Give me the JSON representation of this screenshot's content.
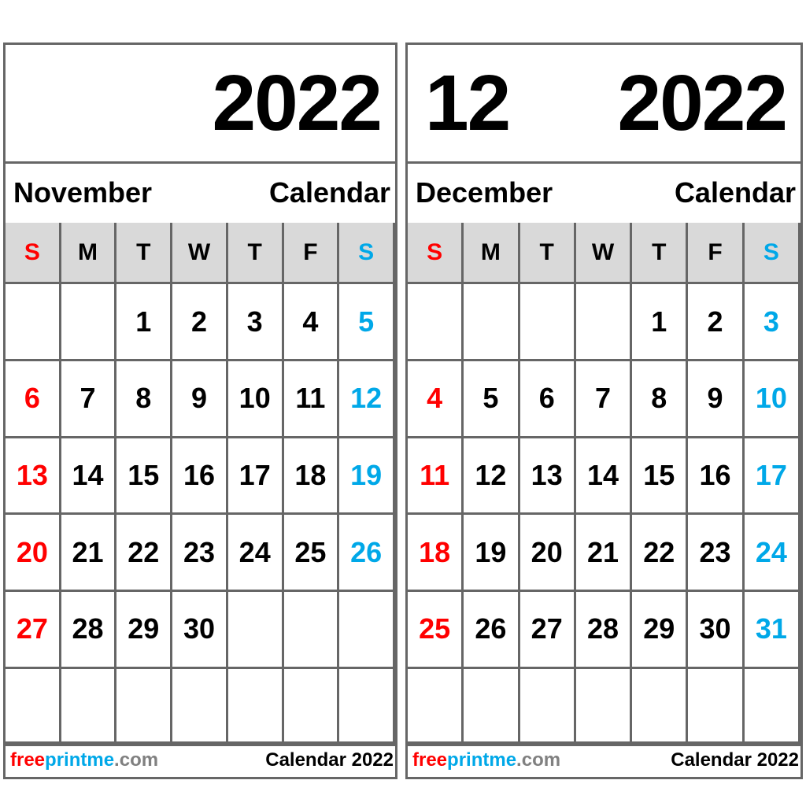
{
  "colors": {
    "sunday": "#ff0000",
    "saturday": "#00a8e8",
    "text": "#000000",
    "header_bg": "#d9d9d9",
    "grid": "#666666",
    "logo_free": "#ff0000",
    "logo_printme": "#00a8e8",
    "logo_com": "#808080"
  },
  "weekdays": [
    "S",
    "M",
    "T",
    "W",
    "T",
    "F",
    "S"
  ],
  "left": {
    "year": "2022",
    "month_name": "November",
    "calendar_label": "Calendar",
    "days": [
      [
        "",
        "",
        "1",
        "2",
        "3",
        "4",
        "5"
      ],
      [
        "6",
        "7",
        "8",
        "9",
        "10",
        "11",
        "12"
      ],
      [
        "13",
        "14",
        "15",
        "16",
        "17",
        "18",
        "19"
      ],
      [
        "20",
        "21",
        "22",
        "23",
        "24",
        "25",
        "26"
      ],
      [
        "27",
        "28",
        "29",
        "30",
        "",
        "",
        ""
      ],
      [
        "",
        "",
        "",
        "",
        "",
        "",
        ""
      ]
    ],
    "footer": {
      "logo_free": "free",
      "logo_printme": "printme",
      "logo_com": ".com",
      "label": "Calendar 2022"
    }
  },
  "right": {
    "month_number": "12",
    "year": "2022",
    "month_name": "December",
    "calendar_label": "Calendar",
    "days": [
      [
        "",
        "",
        "",
        "",
        "1",
        "2",
        "3"
      ],
      [
        "4",
        "5",
        "6",
        "7",
        "8",
        "9",
        "10"
      ],
      [
        "11",
        "12",
        "13",
        "14",
        "15",
        "16",
        "17"
      ],
      [
        "18",
        "19",
        "20",
        "21",
        "22",
        "23",
        "24"
      ],
      [
        "25",
        "26",
        "27",
        "28",
        "29",
        "30",
        "31"
      ],
      [
        "",
        "",
        "",
        "",
        "",
        "",
        ""
      ]
    ],
    "footer": {
      "logo_free": "free",
      "logo_printme": "printme",
      "logo_com": ".com",
      "label": "Calendar 2022"
    }
  }
}
